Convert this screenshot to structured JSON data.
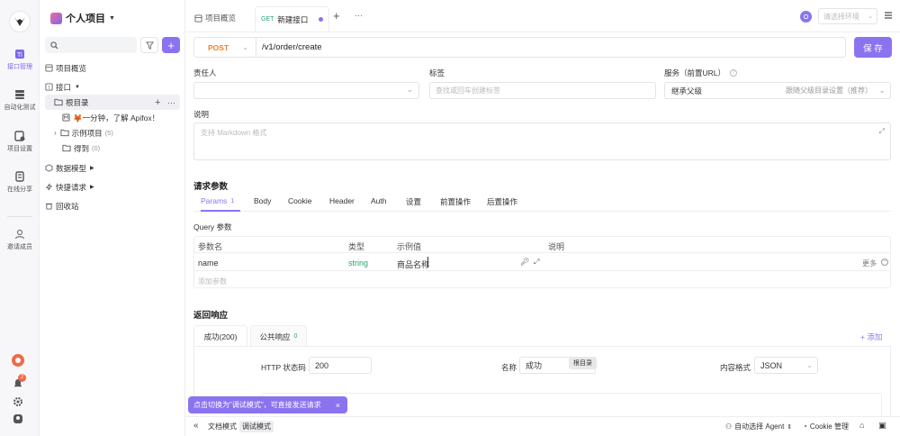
{
  "rail": {
    "items": [
      {
        "label": "接口管理"
      },
      {
        "label": "自动化测试"
      },
      {
        "label": "项目设置"
      },
      {
        "label": "在线分享"
      },
      {
        "label": "邀请成员"
      }
    ],
    "notification_count": "2"
  },
  "sidebar": {
    "project_title": "个人项目",
    "search_placeholder": "",
    "items": {
      "overview": "项目概览",
      "interfaces": "接口",
      "root_dir": "根目录",
      "quickstart": "🦊一分钟，了解 Apifox！",
      "examples": "示例项目",
      "examples_count": "(5)",
      "got": "得到",
      "got_count": "(0)",
      "data_models": "数据模型",
      "quick_requests": "快捷请求",
      "recycle": "回收站"
    }
  },
  "topbar": {
    "tab_overview": "项目概览",
    "tab_method": "GET",
    "tab_new": "新建接口",
    "env_placeholder": "请选择环境"
  },
  "request": {
    "method": "POST",
    "url": "/v1/order/create",
    "save_label": "保 存"
  },
  "meta": {
    "owner_label": "责任人",
    "tags_label": "标签",
    "tags_placeholder": "查找或回车创建标签",
    "service_label": "服务（前置URL）",
    "service_value": "继承父级",
    "service_hint": "跟随父级目录设置（推荐）",
    "desc_label": "说明",
    "desc_placeholder": "支持 Markdown 格式"
  },
  "params": {
    "title": "请求参数",
    "tabs": [
      "Params",
      "Body",
      "Cookie",
      "Header",
      "Auth",
      "设置",
      "前置操作",
      "后置操作"
    ],
    "params_count": "1",
    "query_title": "Query 参数",
    "headers": [
      "参数名",
      "类型",
      "示例值",
      "说明"
    ],
    "rows": [
      {
        "name": "name",
        "type": "string",
        "example": "商品名称",
        "more": "更多"
      }
    ],
    "add_placeholder": "添加参数"
  },
  "response": {
    "title": "返回响应",
    "tab_success": "成功(200)",
    "tab_common": "公共响应",
    "common_count": "0",
    "add_label": "+ 添加",
    "status_label": "HTTP 状态码",
    "status_value": "200",
    "name_label": "名称",
    "name_value": "成功",
    "tooltip": "根目录",
    "format_label": "内容格式",
    "format_value": "JSON"
  },
  "toast": {
    "text": "点击切换为\"调试模式\"，可直接发送请求"
  },
  "bottombar": {
    "doc_mode": "文档模式",
    "debug_mode": "调试模式",
    "agent_label": "自动选择 Agent",
    "cookie_label": "Cookie 管理"
  },
  "colors": {
    "accent": "#8b73f0",
    "string_type": "#2ba471",
    "method_post": "#e8822d"
  }
}
